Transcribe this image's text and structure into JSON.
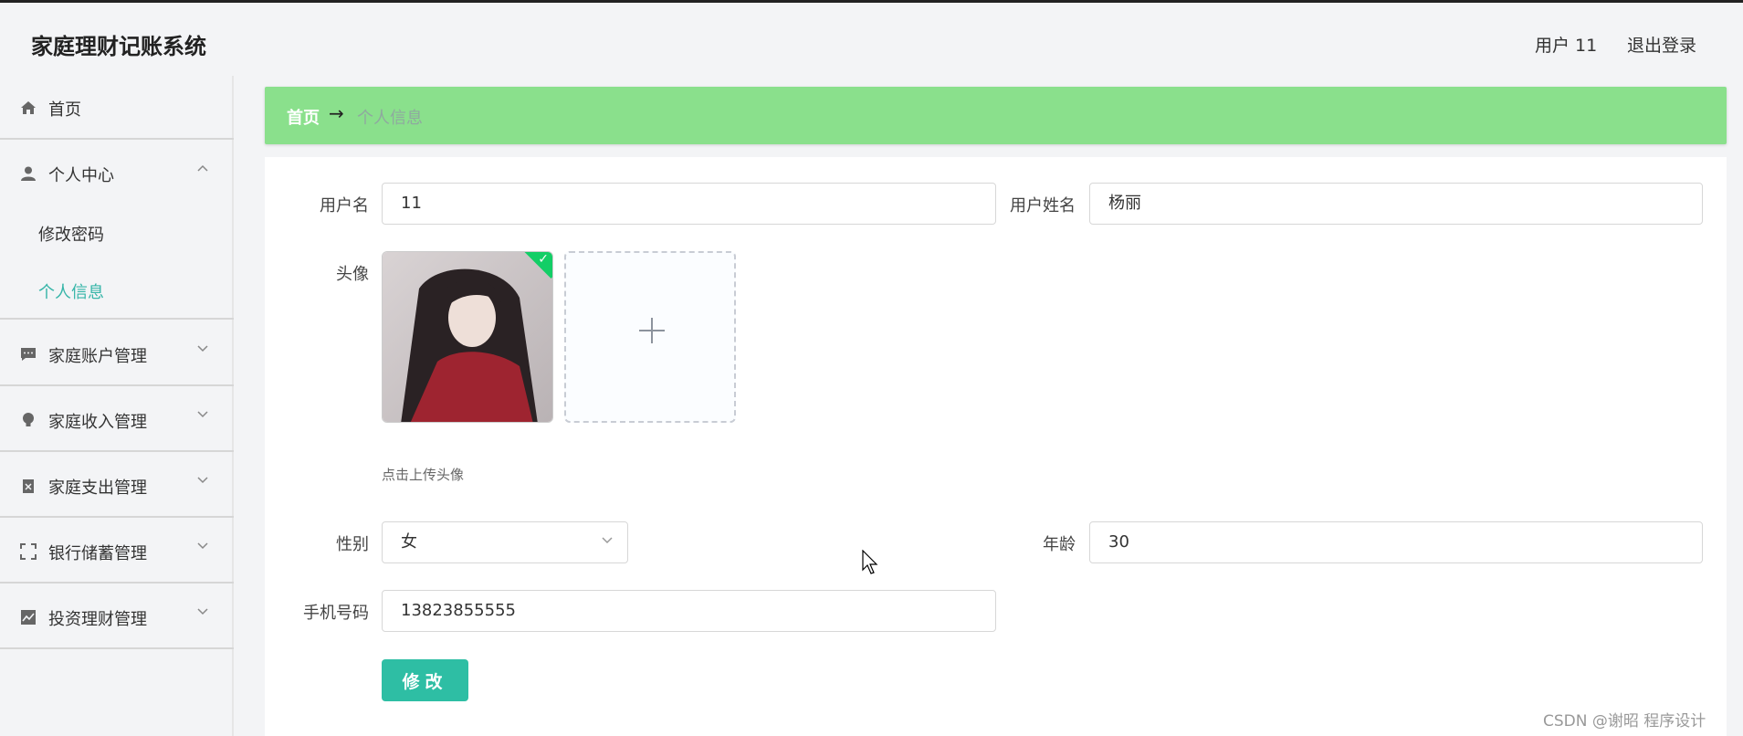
{
  "header": {
    "app_title": "家庭理财记账系统",
    "user_label": "用户 11",
    "logout_label": "退出登录"
  },
  "sidebar": {
    "items": [
      {
        "label": "首页",
        "icon": "home-icon",
        "expandable": false
      },
      {
        "label": "个人中心",
        "icon": "user-icon",
        "expandable": true,
        "expanded": true,
        "children": [
          {
            "label": "修改密码",
            "active": false
          },
          {
            "label": "个人信息",
            "active": true
          }
        ]
      },
      {
        "label": "家庭账户管理",
        "icon": "chat-icon",
        "expandable": true,
        "expanded": false
      },
      {
        "label": "家庭收入管理",
        "icon": "lightbulb-icon",
        "expandable": true,
        "expanded": false
      },
      {
        "label": "家庭支出管理",
        "icon": "clipboard-icon",
        "expandable": true,
        "expanded": false
      },
      {
        "label": "银行储蓄管理",
        "icon": "fullscreen-icon",
        "expandable": true,
        "expanded": false
      },
      {
        "label": "投资理财管理",
        "icon": "chart-icon",
        "expandable": true,
        "expanded": false
      }
    ]
  },
  "breadcrumb": {
    "home": "首页",
    "separator": "→",
    "current": "个人信息"
  },
  "form": {
    "username_label": "用户名",
    "username_value": "11",
    "realname_label": "用户姓名",
    "realname_value": "杨丽",
    "avatar_label": "头像",
    "avatar_upload_hint": "点击上传头像",
    "gender_label": "性别",
    "gender_value": "女",
    "age_label": "年龄",
    "age_value": "30",
    "phone_label": "手机号码",
    "phone_value": "13823855555",
    "submit_label": "修改"
  },
  "watermark": "CSDN @谢昭  程序设计",
  "colors": {
    "breadcrumb_bg": "#8ae08c",
    "accent": "#2ebea4",
    "active_menu_text": "#36b5a8",
    "success_badge": "#13ce66"
  }
}
